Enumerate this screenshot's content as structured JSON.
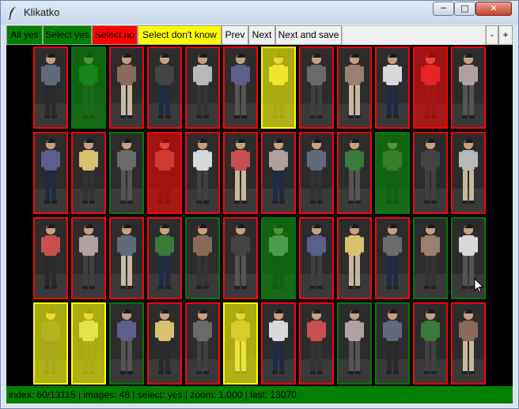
{
  "window": {
    "title": "Klikatko",
    "controls": {
      "minimize": "─",
      "maximize": "□",
      "close": "✕"
    }
  },
  "toolbar": {
    "all_yes": "All yes",
    "select_yes": "Select yes",
    "select_no": "Select no",
    "select_dont_know": "Select don't know",
    "prev": "Prev",
    "next": "Next",
    "next_and_save": "Next and save",
    "zoom_out": "-",
    "zoom_in": "+"
  },
  "colors": {
    "yes": "#008000",
    "no": "#ff0000",
    "dont_know": "#ffff00",
    "canvas": "#000000"
  },
  "grid": {
    "rows": [
      [
        {
          "label": "no",
          "overlay": false
        },
        {
          "label": "yes",
          "overlay": true
        },
        {
          "label": "no",
          "overlay": false
        },
        {
          "label": "no",
          "overlay": false
        },
        {
          "label": "no",
          "overlay": false
        },
        {
          "label": "no",
          "overlay": false
        },
        {
          "label": "dont_know",
          "overlay": true
        },
        {
          "label": "no",
          "overlay": false
        },
        {
          "label": "no",
          "overlay": false
        },
        {
          "label": "no",
          "overlay": false
        },
        {
          "label": "no",
          "overlay": true
        },
        {
          "label": "no",
          "overlay": false
        }
      ],
      [
        {
          "label": "no",
          "overlay": false
        },
        {
          "label": "no",
          "overlay": false
        },
        {
          "label": "yes",
          "overlay": false
        },
        {
          "label": "no",
          "overlay": true
        },
        {
          "label": "no",
          "overlay": false
        },
        {
          "label": "no",
          "overlay": false
        },
        {
          "label": "no",
          "overlay": false
        },
        {
          "label": "no",
          "overlay": false
        },
        {
          "label": "no",
          "overlay": false
        },
        {
          "label": "yes",
          "overlay": true
        },
        {
          "label": "no",
          "overlay": false
        },
        {
          "label": "no",
          "overlay": false
        }
      ],
      [
        {
          "label": "no",
          "overlay": false
        },
        {
          "label": "no",
          "overlay": false
        },
        {
          "label": "no",
          "overlay": false
        },
        {
          "label": "no",
          "overlay": false
        },
        {
          "label": "yes",
          "overlay": false
        },
        {
          "label": "no",
          "overlay": false
        },
        {
          "label": "yes",
          "overlay": true
        },
        {
          "label": "no",
          "overlay": false
        },
        {
          "label": "no",
          "overlay": false
        },
        {
          "label": "no",
          "overlay": false
        },
        {
          "label": "yes",
          "overlay": false
        },
        {
          "label": "yes",
          "overlay": false
        }
      ],
      [
        {
          "label": "dont_know",
          "overlay": true
        },
        {
          "label": "dont_know",
          "overlay": true
        },
        {
          "label": "yes",
          "overlay": false
        },
        {
          "label": "no",
          "overlay": false
        },
        {
          "label": "no",
          "overlay": false
        },
        {
          "label": "dont_know",
          "overlay": true
        },
        {
          "label": "no",
          "overlay": false
        },
        {
          "label": "no",
          "overlay": false
        },
        {
          "label": "yes",
          "overlay": false
        },
        {
          "label": "yes",
          "overlay": false
        },
        {
          "label": "no",
          "overlay": false
        },
        {
          "label": "no",
          "overlay": false
        }
      ]
    ]
  },
  "status": {
    "text": "index: 60/13115 | images: 48 | select: yes | zoom: 1.000 | last: 13070"
  },
  "icons": {
    "app": "feather-icon",
    "cursor": "mouse-pointer-icon"
  }
}
